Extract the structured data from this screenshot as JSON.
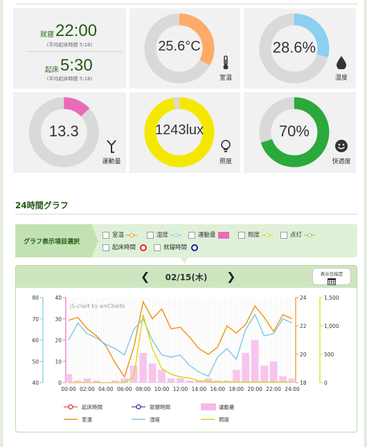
{
  "sleep": {
    "bed_label": "就寝",
    "bed_time": "22:00",
    "bed_avg": "(平均起床時間 5:18)",
    "wake_label": "起床",
    "wake_time": "5:30",
    "wake_avg": "(平均起床時間 5:18)"
  },
  "tiles": [
    {
      "name": "temperature",
      "value": "25.6°C",
      "label": "室温",
      "percent": 0.33,
      "color": "#ffaa66",
      "icon": "thermometer-icon"
    },
    {
      "name": "humidity",
      "value": "28.6%",
      "label": "湿度",
      "percent": 0.29,
      "color": "#8ccff0",
      "icon": "water-drop-icon"
    },
    {
      "name": "activity",
      "value": "13.3",
      "label": "運動量",
      "percent": 0.13,
      "color": "#e86cb8",
      "icon": "activity-icon"
    },
    {
      "name": "illuminance",
      "value": "1243lux",
      "label": "照度",
      "percent": 0.97,
      "color": "#f5e800",
      "icon": "lightbulb-icon"
    },
    {
      "name": "comfort",
      "value": "70%",
      "label": "快適度",
      "percent": 0.7,
      "color": "#2aaa3a",
      "icon": "smiley-icon"
    }
  ],
  "section": {
    "title": "24時間グラフ"
  },
  "selector": {
    "head": "グラフ表示項目選択",
    "options": [
      {
        "label": "室温",
        "kind": "line",
        "color": "#f0900a"
      },
      {
        "label": "湿度",
        "kind": "line",
        "color": "#7ec8e3"
      },
      {
        "label": "運動量",
        "kind": "bar",
        "color": "#e86cb8"
      },
      {
        "label": "照度",
        "kind": "line",
        "color": "#e0d400"
      },
      {
        "label": "点灯",
        "kind": "line",
        "color": "#8cc63f"
      },
      {
        "label": "起床時間",
        "kind": "circle",
        "color": "#e02020"
      },
      {
        "label": "就寝時間",
        "kind": "circle",
        "color": "#1a1a9a"
      }
    ]
  },
  "chart_panel": {
    "date": "02/15(木)",
    "prev": "❮",
    "next": "❯",
    "date_button": "表示日指定",
    "watermark": "JS chart by amCharts"
  },
  "chart_data": {
    "type": "line",
    "x": [
      "00:00",
      "01:00",
      "02:00",
      "03:00",
      "04:00",
      "05:00",
      "06:00",
      "07:00",
      "08:00",
      "09:00",
      "10:00",
      "11:00",
      "12:00",
      "13:00",
      "14:00",
      "15:00",
      "16:00",
      "17:00",
      "18:00",
      "19:00",
      "20:00",
      "21:00",
      "22:00",
      "23:00",
      "24:00"
    ],
    "xticks": [
      "00:00",
      "02:00",
      "04:00",
      "06:00",
      "08:00",
      "10:00",
      "12:00",
      "14:00",
      "16:00",
      "18:00",
      "20:00",
      "22:00",
      "24:00"
    ],
    "axes": {
      "humidity": {
        "ticks": [
          40,
          50,
          60,
          70,
          80
        ],
        "range": [
          40,
          80
        ],
        "color": "#7ec8e3"
      },
      "activity": {
        "ticks": [
          0,
          10,
          20,
          30,
          40
        ],
        "range": [
          0,
          40
        ],
        "color": "#e86cb8"
      },
      "temperature": {
        "ticks": [
          18,
          20,
          22,
          24
        ],
        "range": [
          18,
          24
        ],
        "color": "#f0900a"
      },
      "illuminance": {
        "ticks": [
          "0",
          "500",
          "1,000",
          "1,500"
        ],
        "range": [
          0,
          1500
        ],
        "color": "#e0d400"
      }
    },
    "series": [
      {
        "name": "室温",
        "axis": "temperature",
        "color": "#f0900a",
        "values": [
          22.4,
          22.6,
          21.8,
          21.3,
          20.6,
          19.4,
          18.4,
          20.5,
          23.7,
          22.5,
          23.2,
          21.8,
          21.9,
          21.2,
          20.4,
          20.0,
          20.5,
          22.0,
          21.5,
          22.1,
          23.4,
          22.6,
          21.6,
          22.8,
          22.5
        ]
      },
      {
        "name": "湿度",
        "axis": "humidity",
        "color": "#7ec8e3",
        "values": [
          60,
          68,
          63,
          61,
          58,
          56,
          53,
          65,
          70,
          60,
          53,
          52,
          53,
          48,
          45,
          43,
          52,
          56,
          51,
          65,
          72,
          62,
          63,
          70,
          68
        ]
      },
      {
        "name": "照度",
        "axis": "illuminance",
        "color": "#e0d400",
        "values": [
          0,
          0,
          0,
          0,
          0,
          0,
          0,
          100,
          1200,
          600,
          250,
          150,
          100,
          80,
          30,
          20,
          10,
          10,
          10,
          10,
          10,
          10,
          10,
          10,
          10
        ]
      },
      {
        "name": "運動量",
        "axis": "activity",
        "color": "#f6b8e8",
        "kind": "bar",
        "values": [
          4,
          1,
          2,
          1,
          0,
          1,
          2,
          8,
          14,
          9,
          6,
          2,
          2,
          1,
          1,
          2,
          1,
          1,
          6,
          14,
          20,
          8,
          10,
          3,
          2
        ]
      }
    ],
    "legend": [
      {
        "label": "起床時間",
        "kind": "circle",
        "color": "#e02020"
      },
      {
        "label": "就寝時間",
        "kind": "circle",
        "color": "#1a1a9a"
      },
      {
        "label": "運動量",
        "kind": "box",
        "color": "#f6b8e8"
      },
      {
        "label": "室温",
        "kind": "line",
        "color": "#f0900a"
      },
      {
        "label": "湿度",
        "kind": "line",
        "color": "#7ec8e3"
      },
      {
        "label": "照度",
        "kind": "line",
        "color": "#e0d400"
      }
    ]
  }
}
